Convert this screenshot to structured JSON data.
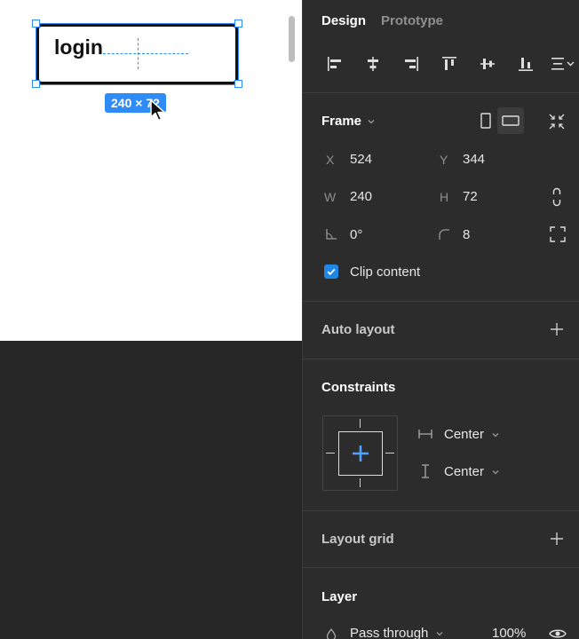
{
  "canvas": {
    "frame_text": "login",
    "dims_badge": "240 × 72"
  },
  "panel": {
    "tabs": [
      {
        "label": "Design",
        "active": true
      },
      {
        "label": "Prototype",
        "active": false
      }
    ],
    "align_icons": [
      "align-left-icon",
      "align-horizontal-center-icon",
      "align-right-icon",
      "align-top-icon",
      "align-vertical-center-icon",
      "align-bottom-icon",
      "distribute-menu-icon"
    ],
    "frame": {
      "title": "Frame",
      "x_label": "X",
      "x_value": "524",
      "y_label": "Y",
      "y_value": "344",
      "w_label": "W",
      "w_value": "240",
      "h_label": "H",
      "h_value": "72",
      "rotation_value": "0°",
      "radius_value": "8",
      "clip_content_label": "Clip content",
      "clip_content_checked": true
    },
    "auto_layout": {
      "title": "Auto layout"
    },
    "constraints": {
      "title": "Constraints",
      "horizontal": "Center",
      "vertical": "Center"
    },
    "layout_grid": {
      "title": "Layout grid"
    },
    "layer": {
      "title": "Layer",
      "blend_mode": "Pass through",
      "opacity": "100%"
    }
  },
  "colors": {
    "selection_blue": "#2f8bf5",
    "panel_bg": "#2c2c2c",
    "checkbox_blue": "#1f87e8"
  }
}
